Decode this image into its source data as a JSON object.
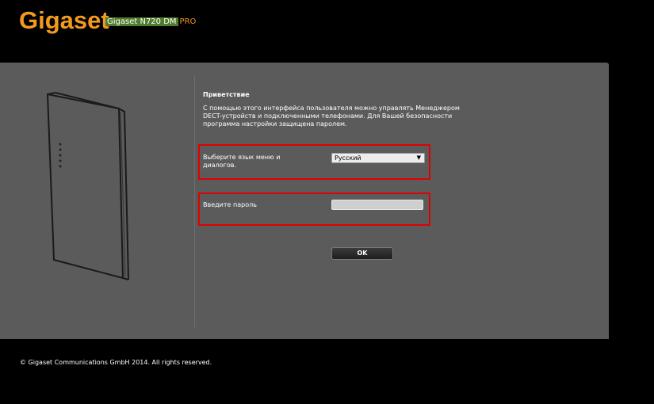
{
  "header": {
    "logo": "Gigaset",
    "model_name": "Gigaset N720 DM",
    "model_suffix": "PRO"
  },
  "welcome": {
    "title": "Приветствие",
    "text": "С помощью этого интерфейса пользователя можно управлять Менеджером DECT-устройств и подключенными телефонами. Для Вашей безопасности программа настройки защищена паролем."
  },
  "language": {
    "label": "Выберите язык меню и диалогов.",
    "selected": "Русский"
  },
  "password": {
    "label": "Введите пароль",
    "value": ""
  },
  "ok_button": "OK",
  "footer": "© Gigaset Communications GmbH 2014. All rights reserved.",
  "colors": {
    "brand_orange": "#f39a1e",
    "model_green": "#4e7d2f",
    "panel_gray": "#5b5b5b",
    "highlight_red": "#e00000"
  }
}
